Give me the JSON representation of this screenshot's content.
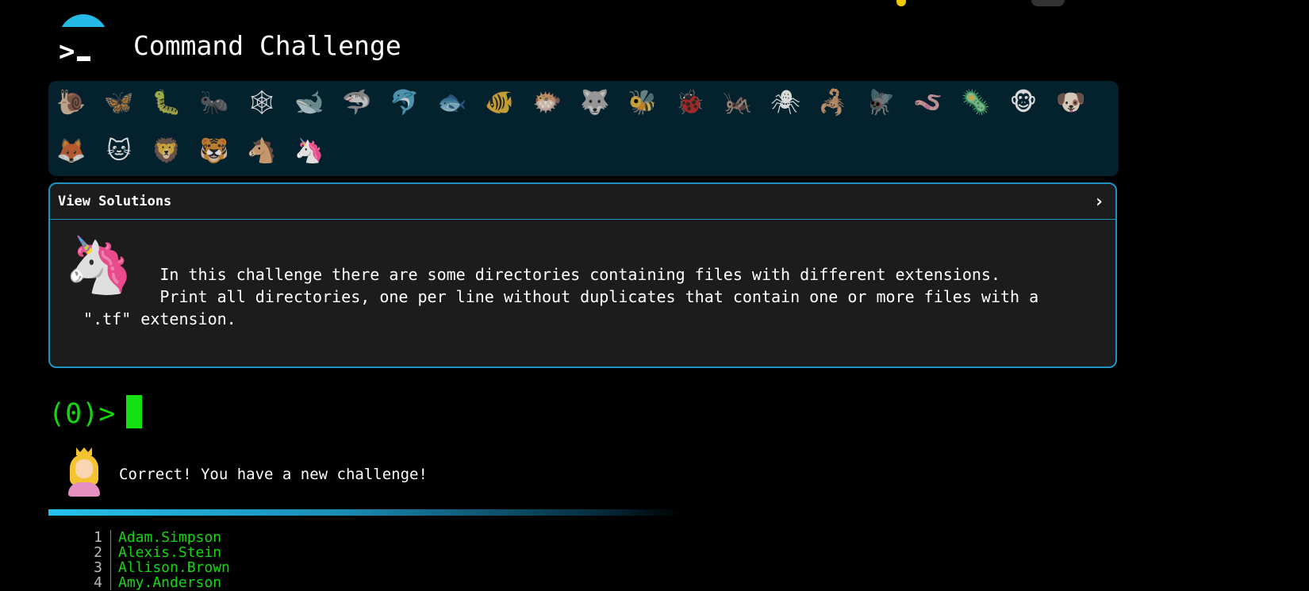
{
  "app": {
    "title": "Command Challenge"
  },
  "animals": [
    {
      "name": "snail",
      "glyph": "🐌"
    },
    {
      "name": "butterfly",
      "glyph": "🦋"
    },
    {
      "name": "caterpillar",
      "glyph": "🐛"
    },
    {
      "name": "ant",
      "glyph": "🐜"
    },
    {
      "name": "spider-web",
      "glyph": "🕸"
    },
    {
      "name": "whale",
      "glyph": "🐋"
    },
    {
      "name": "shark",
      "glyph": "🦈"
    },
    {
      "name": "dolphin",
      "glyph": "🐬"
    },
    {
      "name": "fish",
      "glyph": "🐟"
    },
    {
      "name": "tropical-fish",
      "glyph": "🐠"
    },
    {
      "name": "blowfish",
      "glyph": "🐡"
    },
    {
      "name": "wolf",
      "glyph": "🐺"
    },
    {
      "name": "bee",
      "glyph": "🐝"
    },
    {
      "name": "ladybug",
      "glyph": "🐞"
    },
    {
      "name": "cricket",
      "glyph": "🦗"
    },
    {
      "name": "spider",
      "glyph": "🕷"
    },
    {
      "name": "scorpion",
      "glyph": "🦂"
    },
    {
      "name": "fly",
      "glyph": "🪰"
    },
    {
      "name": "worm",
      "glyph": "🪱"
    },
    {
      "name": "microbe",
      "glyph": "🦠"
    },
    {
      "name": "monkey",
      "glyph": "🐵"
    },
    {
      "name": "dog",
      "glyph": "🐶"
    },
    {
      "name": "fox",
      "glyph": "🦊"
    },
    {
      "name": "cat",
      "glyph": "🐱"
    },
    {
      "name": "lion",
      "glyph": "🦁"
    },
    {
      "name": "tiger",
      "glyph": "🐯"
    },
    {
      "name": "horse",
      "glyph": "🐴"
    },
    {
      "name": "unicorn",
      "glyph": "🦄"
    }
  ],
  "solutions": {
    "label": "View Solutions",
    "chevron": "›",
    "unicorn_glyph": "🦄",
    "description": "         In this challenge there are some directories containing files with different extensions.\n         Print all directories, one per line without duplicates that contain one or more files with a\n \".tf\" extension."
  },
  "terminal": {
    "prompt": "(0)>"
  },
  "feedback": {
    "message": "Correct! You have a new challenge!"
  },
  "listing": [
    {
      "n": "1",
      "text": "Adam.Simpson"
    },
    {
      "n": "2",
      "text": "Alexis.Stein"
    },
    {
      "n": "3",
      "text": "Allison.Brown"
    },
    {
      "n": "4",
      "text": "Amy.Anderson"
    }
  ]
}
